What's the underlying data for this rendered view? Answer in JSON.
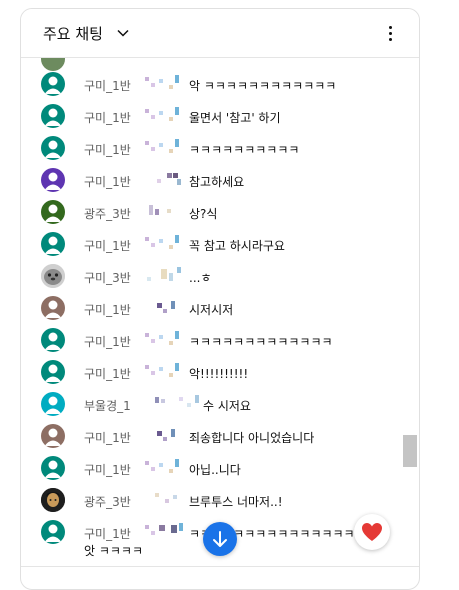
{
  "header": {
    "title": "주요 채팅",
    "dropdown_icon": "chevron-down-icon",
    "menu_icon": "more-vert-icon"
  },
  "messages": [
    {
      "author": "구미_1반",
      "text": "악 ㅋㅋㅋㅋㅋㅋㅋㅋㅋㅋㅋㅋ",
      "avatar_color": "#00897b"
    },
    {
      "author": "구미_1반",
      "text": "울면서 '참고' 하기",
      "avatar_color": "#00897b"
    },
    {
      "author": "구미_1반",
      "text": "ㅋㅋㅋㅋㅋㅋㅋㅋㅋㅋ",
      "avatar_color": "#00897b"
    },
    {
      "author": "구미_1반",
      "text": "참고하세요",
      "avatar_color": "#5e35b1"
    },
    {
      "author": "광주_3반",
      "text": "상?식",
      "avatar_color": "#33691e"
    },
    {
      "author": "구미_1반",
      "text": "꼭 참고 하시라구요",
      "avatar_color": "#00897b"
    },
    {
      "author": "구미_3반",
      "text": "...ㅎ",
      "avatar_color": "photo"
    },
    {
      "author": "구미_1반",
      "text": "시저시저",
      "avatar_color": "#8d6e63"
    },
    {
      "author": "구미_1반",
      "text": "ㅋㅋㅋㅋㅋㅋㅋㅋㅋㅋㅋㅋㅋ",
      "avatar_color": "#00897b"
    },
    {
      "author": "구미_1반",
      "text": "악!!!!!!!!!!",
      "avatar_color": "#00897b"
    },
    {
      "author": "부울경_1",
      "text": "수  시저요",
      "avatar_color": "#00acc1"
    },
    {
      "author": "구미_1반",
      "text": "죄송합니다 아니었습니다",
      "avatar_color": "#8d6e63"
    },
    {
      "author": "구미_1반",
      "text": "아닙..니다",
      "avatar_color": "#00897b"
    },
    {
      "author": "광주_3반",
      "text": "브루투스 너마저..!",
      "avatar_color": "photo2"
    },
    {
      "author": "구미_1반",
      "text": "ㅋㅋㅋㅋㅋㅋㅋㅋㅋㅋㅋㅋㅋㅋㅋ",
      "text_line2": "앗 ㅋㅋㅋㅋ",
      "avatar_color": "#00897b"
    }
  ],
  "buttons": {
    "jump_icon": "arrow-down-icon",
    "reaction_icon": "heart-icon"
  }
}
